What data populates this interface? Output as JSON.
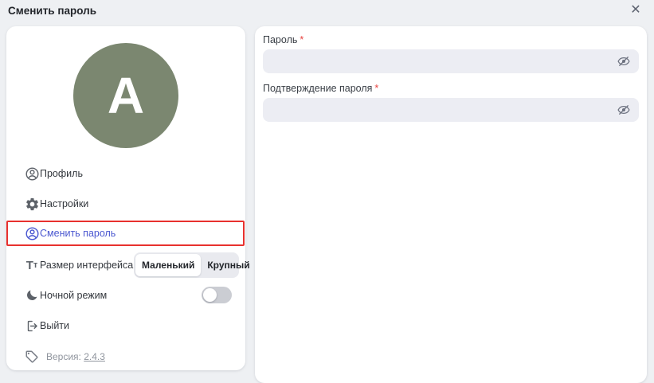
{
  "header": {
    "title": "Сменить пароль",
    "close_glyph": "✕"
  },
  "sidebar": {
    "avatar": {
      "letter": "A",
      "color": "#7b8770"
    },
    "items": [
      {
        "label": "Профиль",
        "icon": "account-circle-icon"
      },
      {
        "label": "Настройки",
        "icon": "gear-icon"
      },
      {
        "label": "Сменить пароль",
        "icon": "account-circle-icon",
        "active": true
      },
      {
        "label": "Размер интерфейса",
        "icon": "text-size-icon"
      },
      {
        "label": "Ночной режим",
        "icon": "moon-icon"
      },
      {
        "label": "Выйти",
        "icon": "logout-icon"
      }
    ],
    "text_size_glyph": {
      "big": "Т",
      "small": "т"
    },
    "size_switch": {
      "options": [
        "Маленький",
        "Крупный"
      ],
      "selected": "Маленький"
    },
    "night_mode": {
      "enabled": false
    },
    "version": {
      "label": "Версия:",
      "value": "2.4.3",
      "icon": "tag-icon"
    }
  },
  "main": {
    "fields": [
      {
        "label": "Пароль",
        "required_mark": "*",
        "value": "",
        "visibility": "hidden"
      },
      {
        "label": "Подтверждение пароля",
        "required_mark": "*",
        "value": "",
        "visibility": "hidden"
      }
    ]
  },
  "colors": {
    "accent": "#4a57d0",
    "highlight_border": "#e8312e",
    "avatar": "#7b8770",
    "asterisk": "#e8433f",
    "background": "#eef0f3"
  }
}
